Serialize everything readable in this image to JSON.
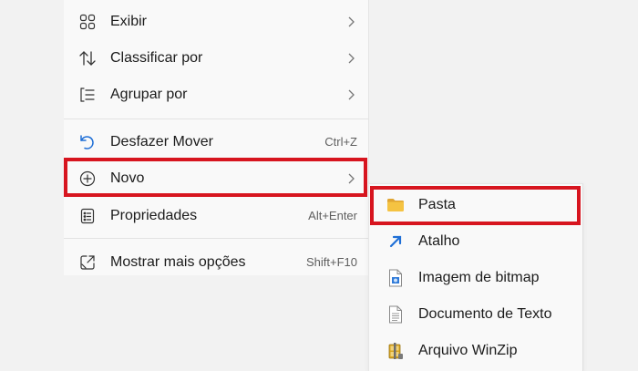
{
  "context_menu": {
    "items": [
      {
        "icon": "grid-view-icon",
        "label": "Exibir",
        "has_submenu": true
      },
      {
        "icon": "sort-arrows-icon",
        "label": "Classificar por",
        "has_submenu": true
      },
      {
        "icon": "group-list-icon",
        "label": "Agrupar por",
        "has_submenu": true
      },
      {
        "icon": "undo-icon",
        "label": "Desfazer Mover",
        "shortcut": "Ctrl+Z"
      },
      {
        "icon": "plus-circle-icon",
        "label": "Novo",
        "has_submenu": true,
        "highlighted": true
      },
      {
        "icon": "properties-icon",
        "label": "Propriedades",
        "shortcut": "Alt+Enter"
      },
      {
        "icon": "open-external-icon",
        "label": "Mostrar mais opções",
        "shortcut": "Shift+F10"
      }
    ]
  },
  "new_submenu": {
    "items": [
      {
        "icon": "folder-icon",
        "label": "Pasta",
        "highlighted": true
      },
      {
        "icon": "shortcut-arrow-icon",
        "label": "Atalho"
      },
      {
        "icon": "bitmap-file-icon",
        "label": "Imagem de bitmap"
      },
      {
        "icon": "text-document-icon",
        "label": "Documento de Texto"
      },
      {
        "icon": "winzip-archive-icon",
        "label": "Arquivo WinZip"
      }
    ]
  },
  "colors": {
    "highlight_border": "#d7151f",
    "menu_background": "#f9f9f9",
    "page_background": "#f2f2f2",
    "folder": "#f5c342",
    "shortcut_arrow": "#1f6fd6"
  }
}
